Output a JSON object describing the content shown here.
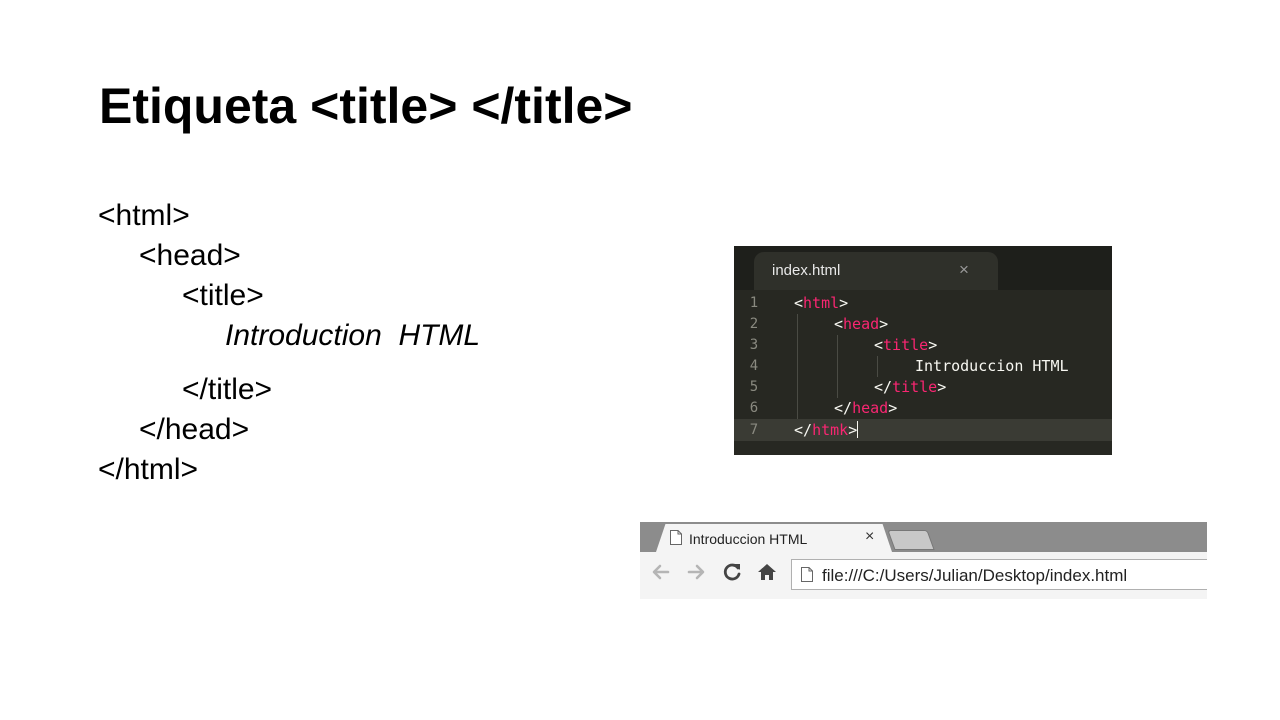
{
  "slide": {
    "title": "Etiqueta <title> </title>",
    "code_lines": [
      "<html>",
      "<head>",
      "<title>",
      "Introduction  HTML",
      "</title>",
      "</head>",
      "</html>"
    ]
  },
  "editor": {
    "tab_label": "index.html",
    "close_glyph": "×",
    "line_numbers": [
      "1",
      "2",
      "3",
      "4",
      "5",
      "6",
      "7"
    ],
    "lines": [
      {
        "open": "<",
        "tag": "html",
        "close": ">"
      },
      {
        "open": "<",
        "tag": "head",
        "close": ">"
      },
      {
        "open": "<",
        "tag": "title",
        "close": ">"
      },
      {
        "text": "Introduccion HTML"
      },
      {
        "open": "</",
        "tag": "title",
        "close": ">"
      },
      {
        "open": "</",
        "tag": "head",
        "close": ">"
      },
      {
        "open": "</",
        "tag": "htmk",
        "close": ">"
      }
    ],
    "colors": {
      "background": "#272822",
      "tag_name": "#f92672",
      "text": "#f8f8f2",
      "gutter": "#8a8a80"
    }
  },
  "browser": {
    "tab_title": "Introduccion HTML",
    "close_glyph": "×",
    "url": "file:///C:/Users/Julian/Desktop/index.html",
    "icons": {
      "tab_page": "page-icon",
      "back": "back-arrow-icon",
      "forward": "forward-arrow-icon",
      "reload": "reload-icon",
      "home": "home-icon",
      "omnibox_page": "page-icon"
    }
  }
}
